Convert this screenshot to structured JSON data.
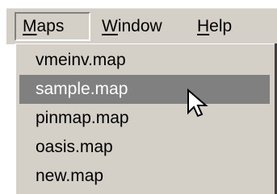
{
  "menubar": {
    "items": [
      {
        "label_mnemonic": "M",
        "label_rest": "aps",
        "state": "open"
      },
      {
        "label_mnemonic": "W",
        "label_rest": "indow",
        "state": "normal"
      },
      {
        "label_mnemonic": "H",
        "label_rest": "elp",
        "state": "normal"
      }
    ]
  },
  "dropdown": {
    "items": [
      {
        "label": "vmeinv.map"
      },
      {
        "label": "sample.map",
        "selected": true
      },
      {
        "label": "pinmap.map"
      },
      {
        "label": "oasis.map"
      },
      {
        "label": "new.map"
      }
    ]
  },
  "colors": {
    "menu_face": "#d4d0c8",
    "highlight": "#808080",
    "highlight_text": "#ffffff",
    "text": "#000000"
  },
  "cursor": {
    "icon": "arrow-pointer-icon"
  }
}
